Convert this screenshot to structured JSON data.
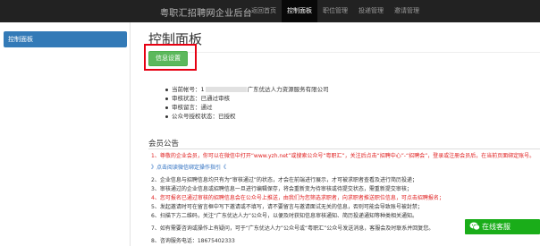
{
  "header": {
    "brand": "粤职汇招聘网企业后台",
    "nav": [
      "返回首页",
      "控制面板",
      "职位管理",
      "投递管理",
      "邀请管理"
    ],
    "active_index": 1
  },
  "sidebar": {
    "items": [
      {
        "label": "控制面板"
      }
    ]
  },
  "main": {
    "title": "控制面板",
    "info_button": "信息设置",
    "account": {
      "number_label": "当前帐号：1",
      "company": "广东优达人力资源服务有限公司",
      "audit": "审核状态：已通过审核",
      "review": "审核留言：通过",
      "wechat_auth": "公众号授权状态：已授权"
    },
    "announcement": {
      "title": "会员公告",
      "lines": [
        {
          "text": "1、尊敬的企业会员，你可以在微信中打开“www.yzh.net”或搜索公众号“粤职汇”，关注后点击“招聘中心”-“招聘会”，登录或注册会员后，在当前页面绑定账号。",
          "color": "red"
        },
        {
          "text": "》点击阅读微信绑定操作指引《",
          "color": "blue"
        },
        {
          "text": "2、企业信息与招聘信息均只有为“审核通过”的状态，才会在前端进行展示，才可被求职者查看及进行简历投递；",
          "color": "dark"
        },
        {
          "text": "3、审核通过的企业信息或招聘信息一旦进行编辑保存，将会重新变为待审核或待提交状态，需重新提交审核；",
          "color": "dark"
        },
        {
          "text": "4、您可报名已通过审核的招聘信息会在公众号上推送，由我们为您筛选求职者，向求职者推送职位信息，可点击招聘报名；",
          "color": "red"
        },
        {
          "text": "5、发起邀请时可在留言框中写下邀请或不填写，请不要留言与邀请面试无关的信息，否则可能会导致账号被封禁；",
          "color": "dark"
        },
        {
          "text": "6、扫描下方二维码，关注“广东优达人力”公众号，以便及时获知信息审核通知、简历投递通知等种类相关通知。",
          "color": "dark"
        },
        {
          "text": "7、如有需要咨询或操作上有疑问，可于“广东优达人力”公众号或“粤职汇”公众号发送消息，客服会及时联系并回复您。",
          "color": "dark"
        },
        {
          "text": "8、咨询服务电话：18675402333",
          "color": "dark"
        }
      ]
    }
  },
  "chat": {
    "label": "在线客服",
    "color": "#1aad19"
  },
  "colors": {
    "topbar": "#222222",
    "sidebar_active": "#337ab7",
    "button": "#5cb85c",
    "highlight": "#e60012",
    "red_text": "#e02020",
    "blue_text": "#2a6dc0"
  }
}
